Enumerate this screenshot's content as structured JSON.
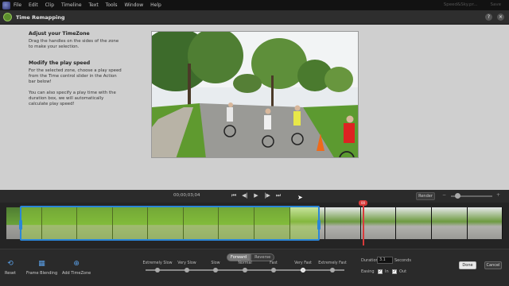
{
  "menu": {
    "items": [
      "File",
      "Edit",
      "Clip",
      "Timeline",
      "Text",
      "Tools",
      "Window",
      "Help"
    ],
    "right": [
      "Speed&Sky.pr...",
      "Save"
    ]
  },
  "dialog": {
    "title": "Time Remapping",
    "help_icon": "help-icon",
    "close_icon": "close-icon"
  },
  "instructions": {
    "heading1": "Adjust your TimeZone",
    "text1": "Drag the handles on the sides of the zone to make your selection.",
    "heading2": "Modify the play speed",
    "text2": "For the selected zone, choose a play speed from the Time control slider in the Action bar below!",
    "text3": "You can also specify a play time with the duration box, we will automatically calculate play speed!"
  },
  "transport": {
    "timecode": "00;00;03;04",
    "render_label": "Render",
    "zoom_minus": "−",
    "zoom_plus": "+"
  },
  "timeline": {
    "playhead_label": "00"
  },
  "actionbar": {
    "reset_label": "Reset",
    "frame_blending_label": "Frame Blending",
    "add_timezone_label": "Add TimeZone",
    "forward_label": "Forward",
    "reverse_label": "Reverse",
    "speeds": [
      "Extremely Slow",
      "Very Slow",
      "Slow",
      "Normal",
      "Fast",
      "Very Fast",
      "Extremely Fast"
    ],
    "selected_speed": "Very Fast",
    "duration_label": "Duration",
    "duration_value": "3.1",
    "duration_unit": "Seconds",
    "easing_label": "Easing",
    "easing_in_label": "In",
    "easing_out_label": "Out",
    "done_label": "Done",
    "cancel_label": "Cancel"
  },
  "colors": {
    "zone_border": "#2a86d8",
    "playhead": "#d83a3a",
    "panel_bg": "#cfcfcf"
  }
}
